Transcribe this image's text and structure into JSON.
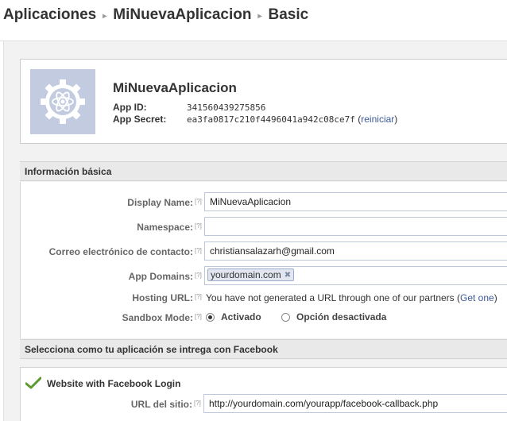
{
  "breadcrumb": {
    "items": [
      "Aplicaciones",
      "MiNuevaAplicacion",
      "Basic"
    ],
    "separator": "▸"
  },
  "app": {
    "name": "MiNuevaAplicacion",
    "app_id_label": "App ID:",
    "app_id": "341560439275856",
    "secret_label": "App Secret:",
    "secret": "ea3fa0817c210f4496041a942c08ce7f",
    "reset_open": "(",
    "reset_link": "reiniciar",
    "reset_close": ")",
    "icon": "gear-atom-icon"
  },
  "basic_info": {
    "heading": "Información básica",
    "help": "[?]",
    "display_name": {
      "label": "Display Name:",
      "value": "MiNuevaAplicacion"
    },
    "namespace": {
      "label": "Namespace:",
      "value": ""
    },
    "contact_email": {
      "label": "Correo electrónico de contacto:",
      "value": "christiansalazarh@gmail.com"
    },
    "app_domains": {
      "label": "App Domains:",
      "tokens": [
        "yourdomain.com"
      ]
    },
    "hosting_url": {
      "label": "Hosting URL:",
      "text": "You have not generated a URL through one of our partners (",
      "link": "Get one",
      "close": ")"
    },
    "sandbox": {
      "label": "Sandbox Mode:",
      "options": [
        "Activado",
        "Opción desactivada"
      ],
      "selected": "Activado"
    }
  },
  "integration": {
    "heading": "Selecciona como tu aplicación se intrega con Facebook",
    "website": {
      "title": "Website with Facebook Login",
      "site_url_label": "URL del sitio:",
      "site_url": "http://yourdomain.com/yourapp/facebook-callback.php"
    }
  },
  "colors": {
    "link": "#3b5998",
    "icon_bg": "#c3cbe0",
    "check": "#5b9b2e"
  }
}
